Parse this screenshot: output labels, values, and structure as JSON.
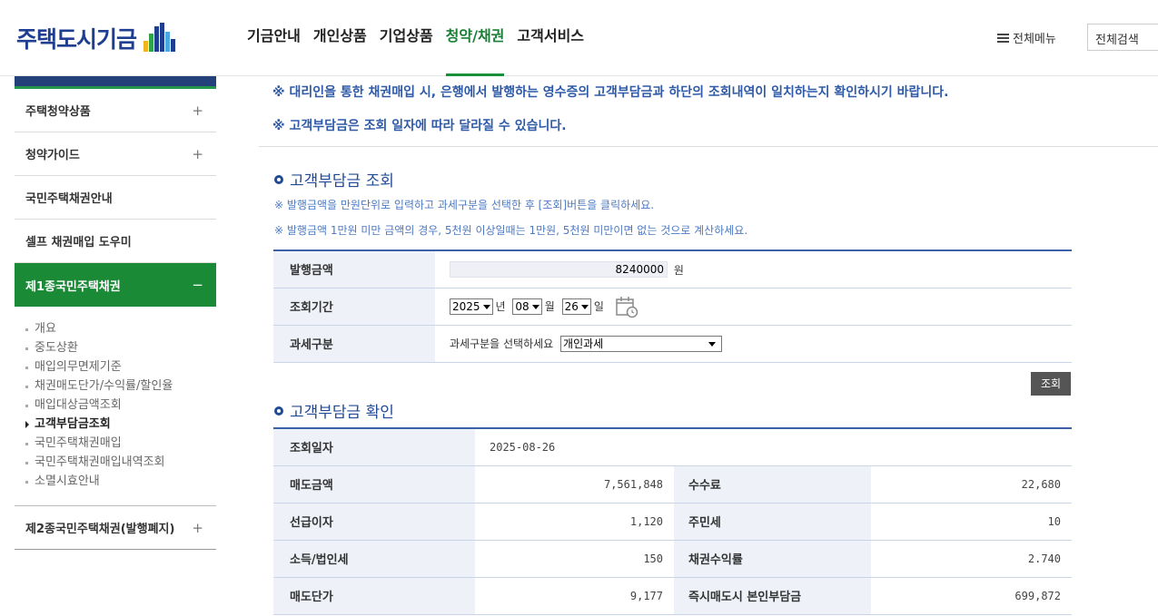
{
  "header": {
    "logo_text": "주택도시기금",
    "gnb": [
      "기금안내",
      "개인상품",
      "기업상품",
      "청약/채권",
      "고객서비스"
    ],
    "active_gnb": "청약/채권",
    "allmenu_label": "전체메뉴",
    "search_label": "전체검색"
  },
  "sidebar": {
    "items_top": [
      {
        "label": "주택청약상품",
        "pm": "+"
      },
      {
        "label": "청약가이드",
        "pm": "+"
      },
      {
        "label": "국민주택채권안내",
        "pm": ""
      },
      {
        "label": "셀프 채권매입 도우미",
        "pm": ""
      }
    ],
    "active_item": {
      "label": "제1종국민주택채권",
      "pm": "−"
    },
    "sub_items": [
      "개요",
      "중도상환",
      "매입의무면제기준",
      "채권매도단가/수익률/할인율",
      "매입대상금액조회",
      "고객부담금조회",
      "국민주택채권매입",
      "국민주택채권매입내역조회",
      "소멸시효안내"
    ],
    "current_sub": "고객부담금조회",
    "last_item": {
      "label": "제2종국민주택채권(발행폐지)",
      "pm": "+"
    }
  },
  "notices": [
    "※ 대리인을 통한 채권매입 시, 은행에서 발행하는 영수증의 고객부담금과 하단의 조회내역이 일치하는지 확인하시기 바랍니다.",
    "※ 고객부담금은 조회 일자에 따라 달라질 수 있습니다."
  ],
  "query": {
    "title": "고객부담금 조회",
    "guides": [
      "※ 발행금액을 만원단위로 입력하고 과세구분을 선택한 후 [조회]버튼을 클릭하세요.",
      "※ 발행금액 1만원 미만 금액의 경우, 5천원 이상일때는 1만원, 5천원 미만이면 없는 것으로 계산하세요."
    ],
    "amount_label": "발행금액",
    "amount_value": "8240000",
    "amount_unit": "원",
    "period_label": "조회기간",
    "year": "2025",
    "year_unit": "년",
    "month": "08",
    "month_unit": "월",
    "day": "26",
    "day_unit": "일",
    "tax_label": "과세구분",
    "tax_prompt": "과세구분을 선택하세요",
    "tax_value": "개인과세",
    "button_label": "조회"
  },
  "result": {
    "title": "고객부담금 확인",
    "date_label": "조회일자",
    "date_value": "2025-08-26",
    "rows": [
      {
        "l1": "매도금액",
        "v1": "7,561,848",
        "l2": "수수료",
        "v2": "22,680"
      },
      {
        "l1": "선급이자",
        "v1": "1,120",
        "l2": "주민세",
        "v2": "10"
      },
      {
        "l1": "소득/법인세",
        "v1": "150",
        "l2": "채권수익률",
        "v2": "2.740"
      },
      {
        "l1": "매도단가",
        "v1": "9,177",
        "l2": "즉시매도시 본인부담금",
        "v2": "699,872"
      }
    ]
  }
}
